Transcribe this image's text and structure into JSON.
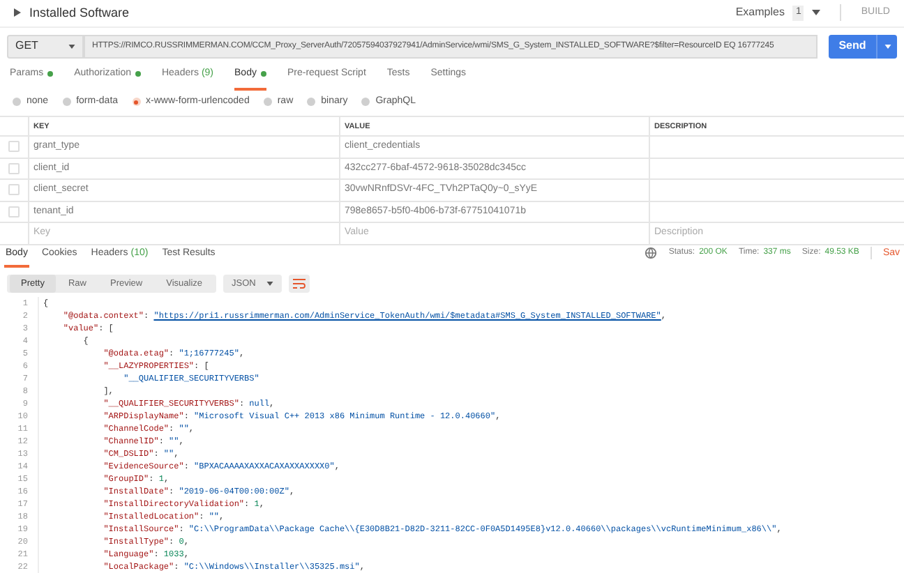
{
  "request": {
    "title": "Installed Software",
    "examples_label": "Examples",
    "examples_count": "1",
    "build_label": "BUILD",
    "method": "GET",
    "url": "HTTPS://RIMCO.RUSSRIMMERMAN.COM/CCM_Proxy_ServerAuth/72057594037927941/AdminService/wmi/SMS_G_System_INSTALLED_SOFTWARE?$filter=ResourceID EQ 16777245",
    "send_label": "Send"
  },
  "tabs": [
    {
      "label": "Params",
      "dot": true,
      "selected": false
    },
    {
      "label": "Authorization",
      "dot": true,
      "selected": false
    },
    {
      "label": "Headers",
      "count": "(9)",
      "dot": false,
      "selected": false
    },
    {
      "label": "Body",
      "dot": true,
      "selected": true
    },
    {
      "label": "Pre-request Script",
      "dot": false,
      "selected": false
    },
    {
      "label": "Tests",
      "dot": false,
      "selected": false
    },
    {
      "label": "Settings",
      "dot": false,
      "selected": false
    }
  ],
  "body_types": [
    {
      "label": "none",
      "selected": false
    },
    {
      "label": "form-data",
      "selected": false
    },
    {
      "label": "x-www-form-urlencoded",
      "selected": true
    },
    {
      "label": "raw",
      "selected": false
    },
    {
      "label": "binary",
      "selected": false
    },
    {
      "label": "GraphQL",
      "selected": false
    }
  ],
  "table": {
    "columns": [
      "KEY",
      "VALUE",
      "DESCRIPTION"
    ],
    "rows": [
      {
        "key": "grant_type",
        "value": "client_credentials",
        "checked": false
      },
      {
        "key": "client_id",
        "value": "432cc277-6baf-4572-9618-35028dc345cc",
        "checked": false
      },
      {
        "key": "client_secret",
        "value": "30vwNRnfDSVr-4FC_TVh2PTaQ0y~0_sYyE",
        "checked": false
      },
      {
        "key": "tenant_id",
        "value": "798e8657-b5f0-4b06-b73f-67751041071b",
        "checked": false
      }
    ],
    "placeholders": {
      "key": "Key",
      "value": "Value",
      "description": "Description"
    }
  },
  "response_tabs": [
    {
      "label": "Body",
      "selected": true
    },
    {
      "label": "Cookies",
      "selected": false
    },
    {
      "label": "Headers",
      "count": "(10)",
      "selected": false
    },
    {
      "label": "Test Results",
      "selected": false
    }
  ],
  "status": [
    {
      "label": "Status:",
      "value": "200 OK"
    },
    {
      "label": "Time:",
      "value": "337 ms"
    },
    {
      "label": "Size:",
      "value": "49.53 KB"
    }
  ],
  "save_label": "Sav",
  "views": [
    {
      "label": "Pretty",
      "selected": true
    },
    {
      "label": "Raw",
      "selected": false
    },
    {
      "label": "Preview",
      "selected": false
    },
    {
      "label": "Visualize",
      "selected": false
    }
  ],
  "format": "JSON",
  "code": [
    {
      "n": "1",
      "tokens": [
        {
          "kind": "punct",
          "text": "{"
        }
      ]
    },
    {
      "n": "2",
      "tokens": [
        {
          "kind": "key",
          "text": "    \"@odata.context\""
        },
        {
          "kind": "punct",
          "text": ": "
        },
        {
          "kind": "link",
          "text": "\"https://pri1.russrimmerman.com/AdminService_TokenAuth/wmi/$metadata#SMS_G_System_INSTALLED_SOFTWARE\""
        },
        {
          "kind": "punct",
          "text": ","
        }
      ]
    },
    {
      "n": "3",
      "tokens": [
        {
          "kind": "key",
          "text": "    \"value\""
        },
        {
          "kind": "punct",
          "text": ": ["
        }
      ]
    },
    {
      "n": "4",
      "tokens": [
        {
          "kind": "punct",
          "text": "        {"
        }
      ]
    },
    {
      "n": "5",
      "tokens": [
        {
          "kind": "key",
          "text": "            \"@odata.etag\""
        },
        {
          "kind": "punct",
          "text": ": "
        },
        {
          "kind": "string",
          "text": "\"1;16777245\""
        },
        {
          "kind": "punct",
          "text": ","
        }
      ]
    },
    {
      "n": "6",
      "tokens": [
        {
          "kind": "key",
          "text": "            \"__LAZYPROPERTIES\""
        },
        {
          "kind": "punct",
          "text": ": ["
        }
      ]
    },
    {
      "n": "7",
      "tokens": [
        {
          "kind": "string",
          "text": "                \"__QUALIFIER_SECURITYVERBS\""
        }
      ]
    },
    {
      "n": "8",
      "tokens": [
        {
          "kind": "punct",
          "text": "            ],"
        }
      ]
    },
    {
      "n": "9",
      "tokens": [
        {
          "kind": "key",
          "text": "            \"__QUALIFIER_SECURITYVERBS\""
        },
        {
          "kind": "punct",
          "text": ": "
        },
        {
          "kind": "string",
          "text": "null"
        },
        {
          "kind": "punct",
          "text": ","
        }
      ]
    },
    {
      "n": "10",
      "tokens": [
        {
          "kind": "key",
          "text": "            \"ARPDisplayName\""
        },
        {
          "kind": "punct",
          "text": ": "
        },
        {
          "kind": "string",
          "text": "\"Microsoft Visual C++ 2013 x86 Minimum Runtime - 12.0.40660\""
        },
        {
          "kind": "punct",
          "text": ","
        }
      ]
    },
    {
      "n": "11",
      "tokens": [
        {
          "kind": "key",
          "text": "            \"ChannelCode\""
        },
        {
          "kind": "punct",
          "text": ": "
        },
        {
          "kind": "string",
          "text": "\"\""
        },
        {
          "kind": "punct",
          "text": ","
        }
      ]
    },
    {
      "n": "12",
      "tokens": [
        {
          "kind": "key",
          "text": "            \"ChannelID\""
        },
        {
          "kind": "punct",
          "text": ": "
        },
        {
          "kind": "string",
          "text": "\"\""
        },
        {
          "kind": "punct",
          "text": ","
        }
      ]
    },
    {
      "n": "13",
      "tokens": [
        {
          "kind": "key",
          "text": "            \"CM_DSLID\""
        },
        {
          "kind": "punct",
          "text": ": "
        },
        {
          "kind": "string",
          "text": "\"\""
        },
        {
          "kind": "punct",
          "text": ","
        }
      ]
    },
    {
      "n": "14",
      "tokens": [
        {
          "kind": "key",
          "text": "            \"EvidenceSource\""
        },
        {
          "kind": "punct",
          "text": ": "
        },
        {
          "kind": "string",
          "text": "\"BPXACAAAAXAXXACAXAXXAXXXX0\""
        },
        {
          "kind": "punct",
          "text": ","
        }
      ]
    },
    {
      "n": "15",
      "tokens": [
        {
          "kind": "key",
          "text": "            \"GroupID\""
        },
        {
          "kind": "punct",
          "text": ": "
        },
        {
          "kind": "number",
          "text": "1"
        },
        {
          "kind": "punct",
          "text": ","
        }
      ]
    },
    {
      "n": "16",
      "tokens": [
        {
          "kind": "key",
          "text": "            \"InstallDate\""
        },
        {
          "kind": "punct",
          "text": ": "
        },
        {
          "kind": "string",
          "text": "\"2019-06-04T00:00:00Z\""
        },
        {
          "kind": "punct",
          "text": ","
        }
      ]
    },
    {
      "n": "17",
      "tokens": [
        {
          "kind": "key",
          "text": "            \"InstallDirectoryValidation\""
        },
        {
          "kind": "punct",
          "text": ": "
        },
        {
          "kind": "number",
          "text": "1"
        },
        {
          "kind": "punct",
          "text": ","
        }
      ]
    },
    {
      "n": "18",
      "tokens": [
        {
          "kind": "key",
          "text": "            \"InstalledLocation\""
        },
        {
          "kind": "punct",
          "text": ": "
        },
        {
          "kind": "string",
          "text": "\"\""
        },
        {
          "kind": "punct",
          "text": ","
        }
      ]
    },
    {
      "n": "19",
      "tokens": [
        {
          "kind": "key",
          "text": "            \"InstallSource\""
        },
        {
          "kind": "punct",
          "text": ": "
        },
        {
          "kind": "string",
          "text": "\"C:\\\\ProgramData\\\\Package Cache\\\\{E30D8B21-D82D-3211-82CC-0F0A5D1495E8}v12.0.40660\\\\packages\\\\vcRuntimeMinimum_x86\\\\\""
        },
        {
          "kind": "punct",
          "text": ","
        }
      ]
    },
    {
      "n": "20",
      "tokens": [
        {
          "kind": "key",
          "text": "            \"InstallType\""
        },
        {
          "kind": "punct",
          "text": ": "
        },
        {
          "kind": "number",
          "text": "0"
        },
        {
          "kind": "punct",
          "text": ","
        }
      ]
    },
    {
      "n": "21",
      "tokens": [
        {
          "kind": "key",
          "text": "            \"Language\""
        },
        {
          "kind": "punct",
          "text": ": "
        },
        {
          "kind": "number",
          "text": "1033"
        },
        {
          "kind": "punct",
          "text": ","
        }
      ]
    },
    {
      "n": "22",
      "tokens": [
        {
          "kind": "key",
          "text": "            \"LocalPackage\""
        },
        {
          "kind": "punct",
          "text": ": "
        },
        {
          "kind": "string",
          "text": "\"C:\\\\Windows\\\\Installer\\\\35325.msi\""
        },
        {
          "kind": "punct",
          "text": ","
        }
      ]
    }
  ]
}
